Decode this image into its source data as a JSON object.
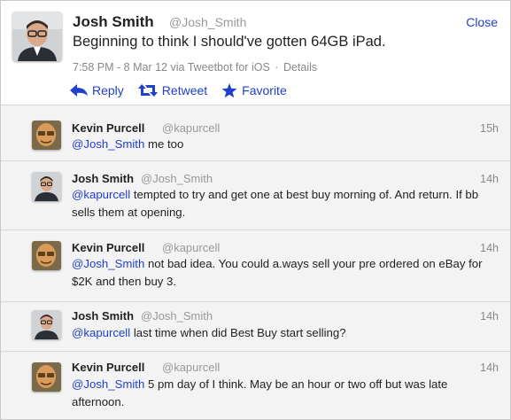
{
  "window": {
    "close_label": "Close"
  },
  "main_tweet": {
    "name": "Josh Smith",
    "handle": "@Josh_Smith",
    "text": "Beginning to think I should've gotten 64GB iPad.",
    "timestamp": "7:58 PM - 8 Mar 12 via Tweetbot for iOS",
    "separator": "·",
    "details_label": "Details"
  },
  "actions": {
    "reply_label": "Reply",
    "retweet_label": "Retweet",
    "favorite_label": "Favorite"
  },
  "colors": {
    "link": "#1f3fcf",
    "muted": "#999999",
    "reply_bg": "#f3f3f3"
  },
  "replies": [
    {
      "name": "Kevin Purcell",
      "handle": "@kapurcell",
      "time": "15h",
      "mention": "@Josh_Smith",
      "text": " me too"
    },
    {
      "name": "Josh Smith",
      "handle": "@Josh_Smith",
      "time": "14h",
      "mention": "@kapurcell",
      "text": " tempted to try and get one at best buy morning of. And return. If bb",
      "text2": "sells them at opening."
    },
    {
      "name": "Kevin Purcell",
      "handle": "@kapurcell",
      "time": "14h",
      "mention": "@Josh_Smith",
      "text": " not bad idea. You could a.ways sell your pre ordered on eBay for",
      "text2": "$2K and then buy 3."
    },
    {
      "name": "Josh Smith",
      "handle": "@Josh_Smith",
      "time": "14h",
      "mention": "@kapurcell",
      "text": " last time when did Best Buy start selling?"
    },
    {
      "name": "Kevin Purcell",
      "handle": "@kapurcell",
      "time": "14h",
      "mention": "@Josh_Smith",
      "text": " 5 pm day of I think. May be an hour or two off but was late",
      "text2": "afternoon."
    }
  ]
}
